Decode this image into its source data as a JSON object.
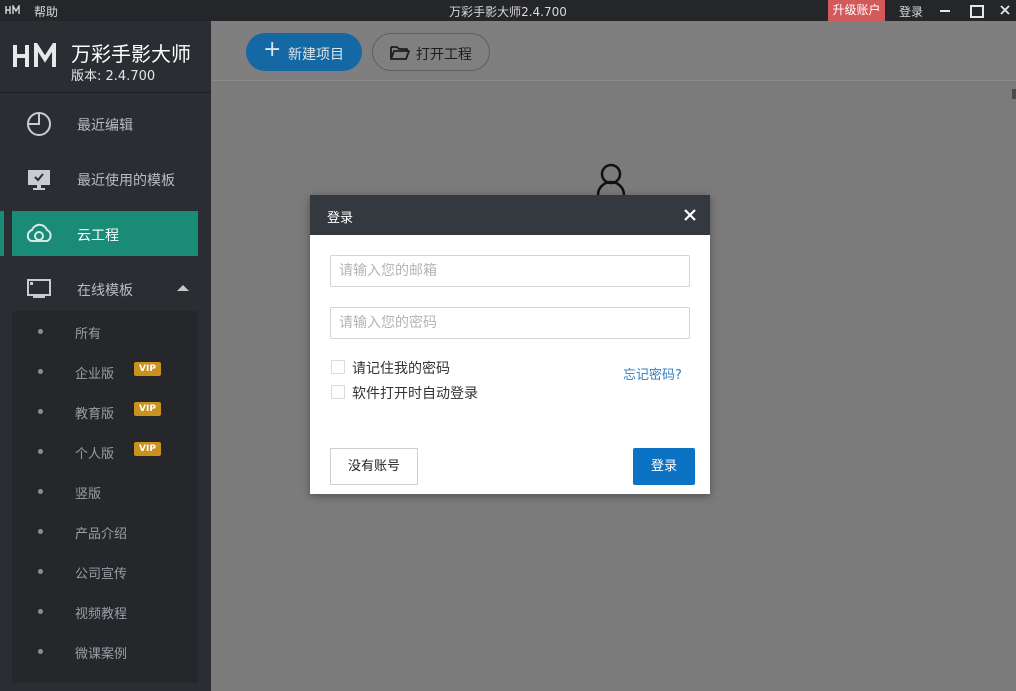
{
  "titlebar": {
    "help": "帮助",
    "title": "万彩手影大师2.4.700",
    "upgrade": "升级账户",
    "login": "登录"
  },
  "brand": {
    "name": "万彩手影大师",
    "version": "版本: 2.4.700"
  },
  "nav": [
    {
      "label": "最近编辑",
      "icon": "pie-chart-icon"
    },
    {
      "label": "最近使用的模板",
      "icon": "monitor-check-icon"
    },
    {
      "label": "云工程",
      "icon": "cloud-icon",
      "active": true
    },
    {
      "label": "在线模板",
      "icon": "monitor-icon",
      "expanded": true
    }
  ],
  "submenu": [
    {
      "label": "所有"
    },
    {
      "label": "企业版",
      "badge": "VIP"
    },
    {
      "label": "教育版",
      "badge": "VIP"
    },
    {
      "label": "个人版",
      "badge": "VIP"
    },
    {
      "label": "竖版"
    },
    {
      "label": "产品介绍"
    },
    {
      "label": "公司宣传"
    },
    {
      "label": "视频教程"
    },
    {
      "label": "微课案例"
    }
  ],
  "toolbar": {
    "new_project": "新建项目",
    "open_project": "打开工程"
  },
  "dialog": {
    "title": "登录",
    "email_placeholder": "请输入您的邮箱",
    "password_placeholder": "请输入您的密码",
    "remember": "请记住我的密码",
    "auto_login": "软件打开时自动登录",
    "forgot": "忘记密码?",
    "no_account": "没有账号",
    "login": "登录"
  },
  "colors": {
    "accent": "#1a8b77",
    "primary_button": "#0c72c4",
    "upgrade": "#d25a5a",
    "vip": "#c7921e"
  }
}
